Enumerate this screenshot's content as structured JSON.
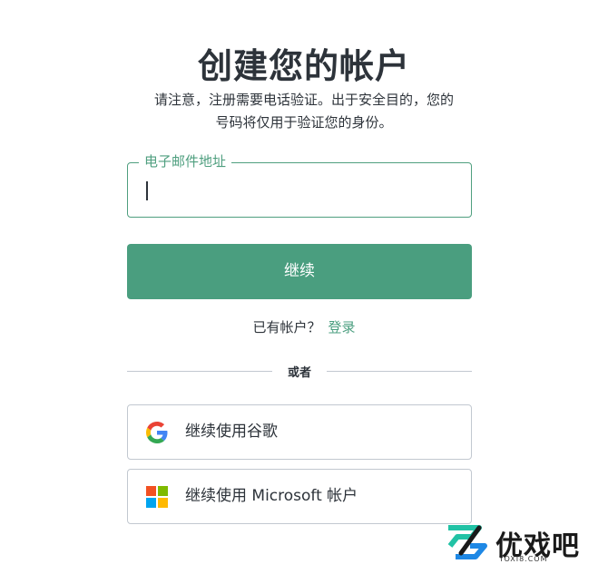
{
  "header": {
    "title": "创建您的帐户",
    "subtitle_line1": "请注意，注册需要电话验证。出于安全目的，您的",
    "subtitle_line2": "号码将仅用于验证您的身份。"
  },
  "form": {
    "email_label": "电子邮件地址",
    "email_value": "",
    "continue_label": "继续",
    "have_account_text": "已有帐户？",
    "login_link": "登录",
    "divider_text": "或者"
  },
  "social": {
    "google_label": "继续使用谷歌",
    "microsoft_label": "继续使用 Microsoft 帐户"
  },
  "watermark": {
    "name": "优戏吧",
    "domain": "YOXI8.COM"
  },
  "colors": {
    "accent": "#4a9e7f",
    "text": "#2d333a",
    "border": "#c2c8d0"
  },
  "icons": {
    "google": "google-logo-icon",
    "microsoft": "microsoft-logo-icon",
    "watermark": "yoxi8-logo-icon"
  }
}
